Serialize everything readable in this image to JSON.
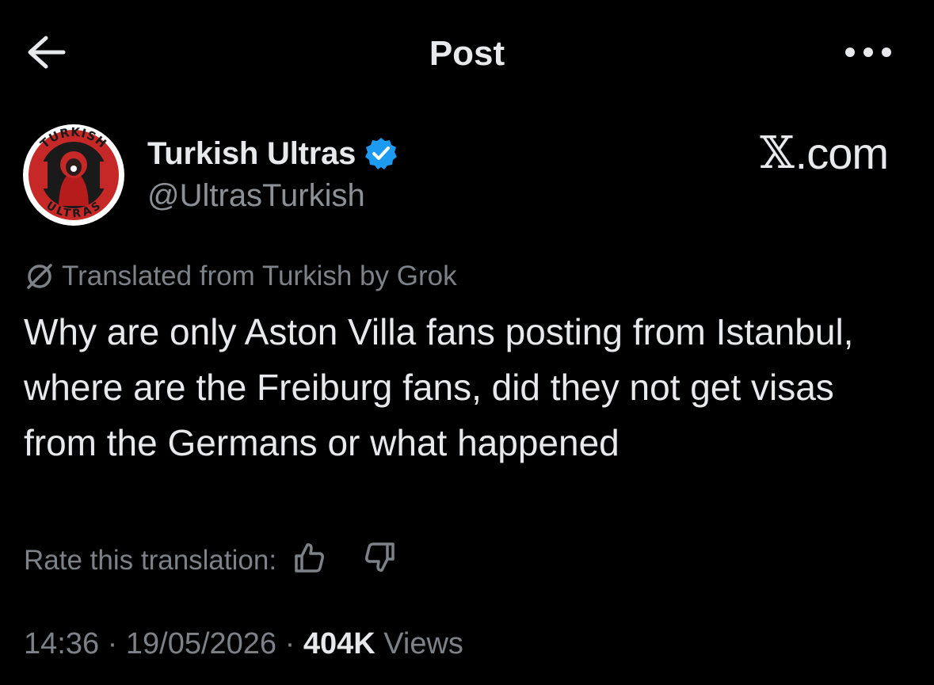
{
  "header": {
    "title": "Post",
    "back_icon": "arrow-left-icon",
    "more_icon": "more-horizontal-icon"
  },
  "author": {
    "name": "Turkish Ultras",
    "handle": "@UltrasTurkish",
    "verified": true,
    "verified_color": "#1d9bf0",
    "avatar_ring_top_text": "TURKISH",
    "avatar_ring_bottom_text": "ULTRAS",
    "avatar_ring_color": "#d32f2f"
  },
  "watermark": {
    "logo_glyph": "𝕏",
    "suffix": ".com"
  },
  "translation": {
    "icon": "translate-icon",
    "label": "Translated from Turkish by Grok"
  },
  "post": {
    "text": "Why are only Aston Villa fans posting from Istanbul, where are the Freiburg fans, did they not get visas from the Germans or what happened"
  },
  "rating": {
    "label": "Rate this translation:",
    "thumbs_up_icon": "thumbs-up-icon",
    "thumbs_down_icon": "thumbs-down-icon"
  },
  "meta": {
    "time": "14:36",
    "separator": " · ",
    "date": "19/05/2026",
    "views_count": "404K",
    "views_label": "Views"
  },
  "colors": {
    "background": "#000000",
    "primary_text": "#e7e9ea",
    "secondary_text": "#7c8288",
    "accent": "#1d9bf0"
  }
}
